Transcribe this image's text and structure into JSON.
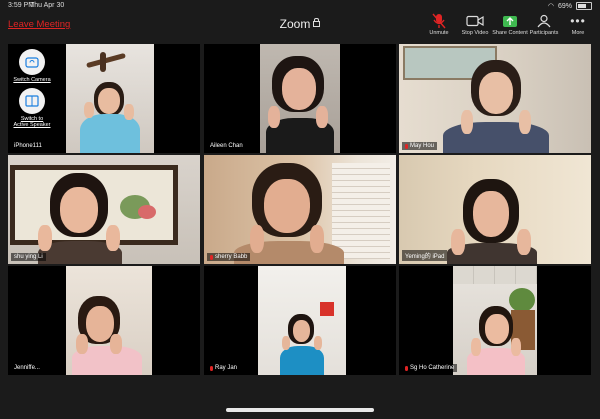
{
  "status_bar": {
    "time": "3:59 PM",
    "date": "Thu Apr 30",
    "battery": "69%"
  },
  "toolbar": {
    "leave_label": "Leave Meeting",
    "title": "Zoom",
    "buttons": [
      {
        "label": "Unmute",
        "icon": "mic-muted-icon"
      },
      {
        "label": "Stop Video",
        "icon": "video-camera-icon"
      },
      {
        "label": "Share Content",
        "icon": "share-screen-icon"
      },
      {
        "label": "Participants",
        "icon": "participants-icon"
      },
      {
        "label": "More",
        "icon": "more-dots-icon"
      }
    ]
  },
  "self_view": {
    "switch_camera": "Switch Camera",
    "switch_speaker": "Switch to Active Speaker"
  },
  "participants": [
    {
      "name": "iPhone111",
      "muted": false
    },
    {
      "name": "Aileen Chan",
      "muted": false
    },
    {
      "name": "May Hou",
      "muted": true
    },
    {
      "name": "shu ying Li",
      "muted": false
    },
    {
      "name": "sherry Babb",
      "muted": true
    },
    {
      "name": "Yeming的 iPad",
      "muted": false
    },
    {
      "name": "Jenniffe...",
      "muted": false
    },
    {
      "name": "Ray Jan",
      "muted": true
    },
    {
      "name": "Sg Ho Catherine",
      "muted": true
    }
  ],
  "colors": {
    "leave": "#e02424",
    "muted_mic": "#e02424",
    "share_green": "#3fb950",
    "background": "#1b1b1b"
  }
}
